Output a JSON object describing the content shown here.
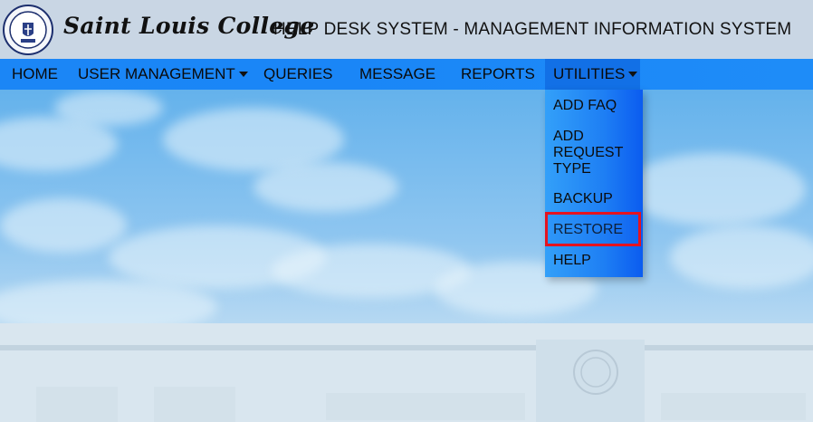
{
  "header": {
    "brand": "Saint Louis College",
    "system_title": "HELP DESK SYSTEM - MANAGEMENT INFORMATION SYSTEM"
  },
  "nav": {
    "items": [
      {
        "label": "HOME"
      },
      {
        "label": "USER MANAGEMENT"
      },
      {
        "label": "QUERIES"
      },
      {
        "label": "MESSAGE"
      },
      {
        "label": "REPORTS"
      },
      {
        "label": "UTILITIES"
      }
    ]
  },
  "utilities_menu": {
    "items": [
      {
        "label": "ADD FAQ"
      },
      {
        "label": "ADD REQUEST TYPE"
      },
      {
        "label": "BACKUP"
      },
      {
        "label": "RESTORE"
      },
      {
        "label": "HELP"
      }
    ],
    "highlighted": "RESTORE"
  },
  "colors": {
    "header_bg": "#c9d6e4",
    "nav_bg": "#1b86f6",
    "active_nav_bg": "#1270e6",
    "highlight_border": "#e5131f"
  },
  "icons": {
    "seal": "college-seal-icon",
    "caret": "caret-down-icon"
  }
}
